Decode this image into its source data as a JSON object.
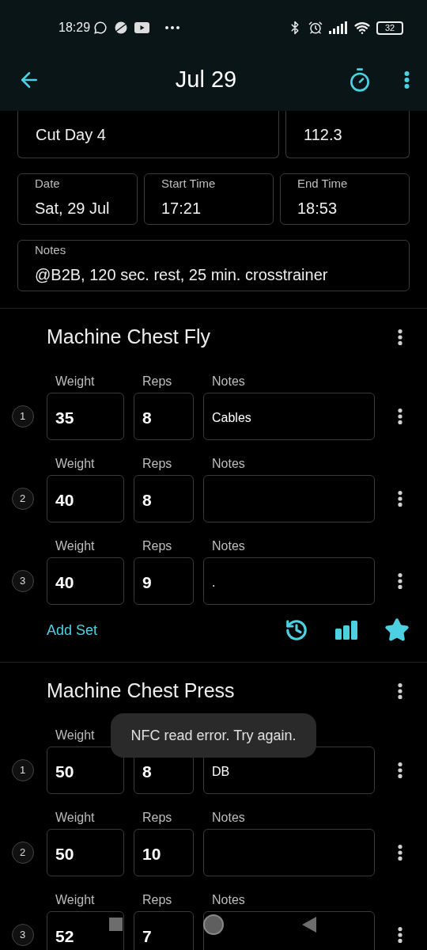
{
  "status_bar": {
    "time": "18:29",
    "battery": "32"
  },
  "app_bar": {
    "title": "Jul 29"
  },
  "workout": {
    "name": "Cut Day 4",
    "bw": "112.3",
    "fields": [
      {
        "label": "Date",
        "value": "Sat, 29 Jul"
      },
      {
        "label": "Start Time",
        "value": "17:21"
      },
      {
        "label": "End Time",
        "value": "18:53"
      }
    ],
    "notes_label": "Notes",
    "notes": "@B2B, 120 sec. rest, 25 min. crosstrainer"
  },
  "exercises": [
    {
      "title": "Machine Chest Fly",
      "add_set": "Add Set",
      "sets": [
        {
          "number": "1",
          "weight_label": "Weight",
          "weight": "35",
          "reps_label": "Reps",
          "reps": "8",
          "notes_label": "Notes",
          "notes": "Cables"
        },
        {
          "number": "2",
          "weight_label": "Weight",
          "weight": "40",
          "reps_label": "Reps",
          "reps": "8",
          "notes_label": "Notes"
        },
        {
          "number": "3",
          "weight_label": "Weight",
          "weight": "40",
          "reps_label": "Reps",
          "reps": "9",
          "notes_label": "Notes",
          "notes": "."
        }
      ]
    },
    {
      "title": "Machine Chest Press",
      "sets": [
        {
          "number": "1",
          "weight_label": "Weight",
          "weight": "50",
          "reps": "8",
          "notes": "DB"
        },
        {
          "number": "2",
          "weight_label": "Weight",
          "weight": "50",
          "reps_label": "Reps",
          "reps": "10",
          "notes_label": "Notes"
        },
        {
          "number": "3",
          "weight_label": "Weight",
          "weight": "52",
          "reps_label": "Reps",
          "reps": "7",
          "notes_label": "Notes"
        }
      ]
    }
  ],
  "toast": "NFC read error. Try again."
}
